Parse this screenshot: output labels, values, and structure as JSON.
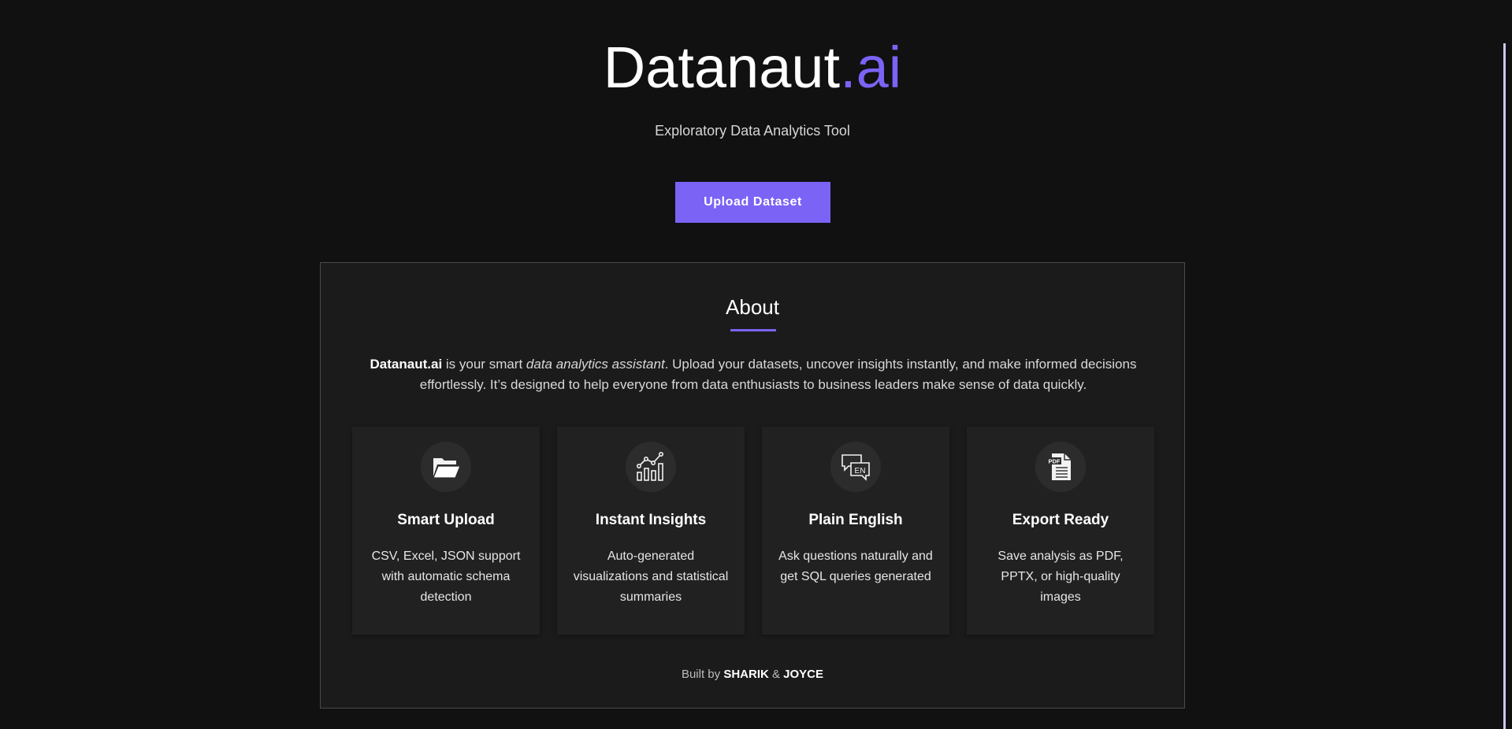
{
  "header": {
    "logo_main": "Datanaut",
    "logo_accent": ".ai",
    "tagline": "Exploratory Data Analytics Tool",
    "upload_label": "Upload Dataset"
  },
  "about": {
    "title": "About",
    "brand": "Datanaut.ai",
    "text_1": " is your smart ",
    "emphasis": "data analytics assistant",
    "text_2": ". Upload your datasets, uncover insights instantly, and make informed decisions effortlessly. It’s designed to help everyone from data enthusiasts to business leaders make sense of data quickly."
  },
  "features": [
    {
      "icon": "folder-icon",
      "title": "Smart Upload",
      "desc": "CSV, Excel, JSON support with automatic schema detection"
    },
    {
      "icon": "chart-icon",
      "title": "Instant Insights",
      "desc": "Auto-generated visualizations and statistical summaries"
    },
    {
      "icon": "chat-en-icon",
      "title": "Plain English",
      "desc": "Ask questions naturally and get SQL queries generated"
    },
    {
      "icon": "pdf-icon",
      "title": "Export Ready",
      "desc": "Save analysis as PDF, PPTX, or high-quality images"
    }
  ],
  "footer": {
    "prefix": "Built by ",
    "author_1": "SHARIK",
    "separator": " & ",
    "author_2": "JOYCE"
  },
  "icon_labels": {
    "en": "EN",
    "pdf": "PDF"
  },
  "colors": {
    "background": "#111111",
    "accent": "#7b63f5",
    "panel": "#1b1b1b",
    "card": "#212121"
  }
}
